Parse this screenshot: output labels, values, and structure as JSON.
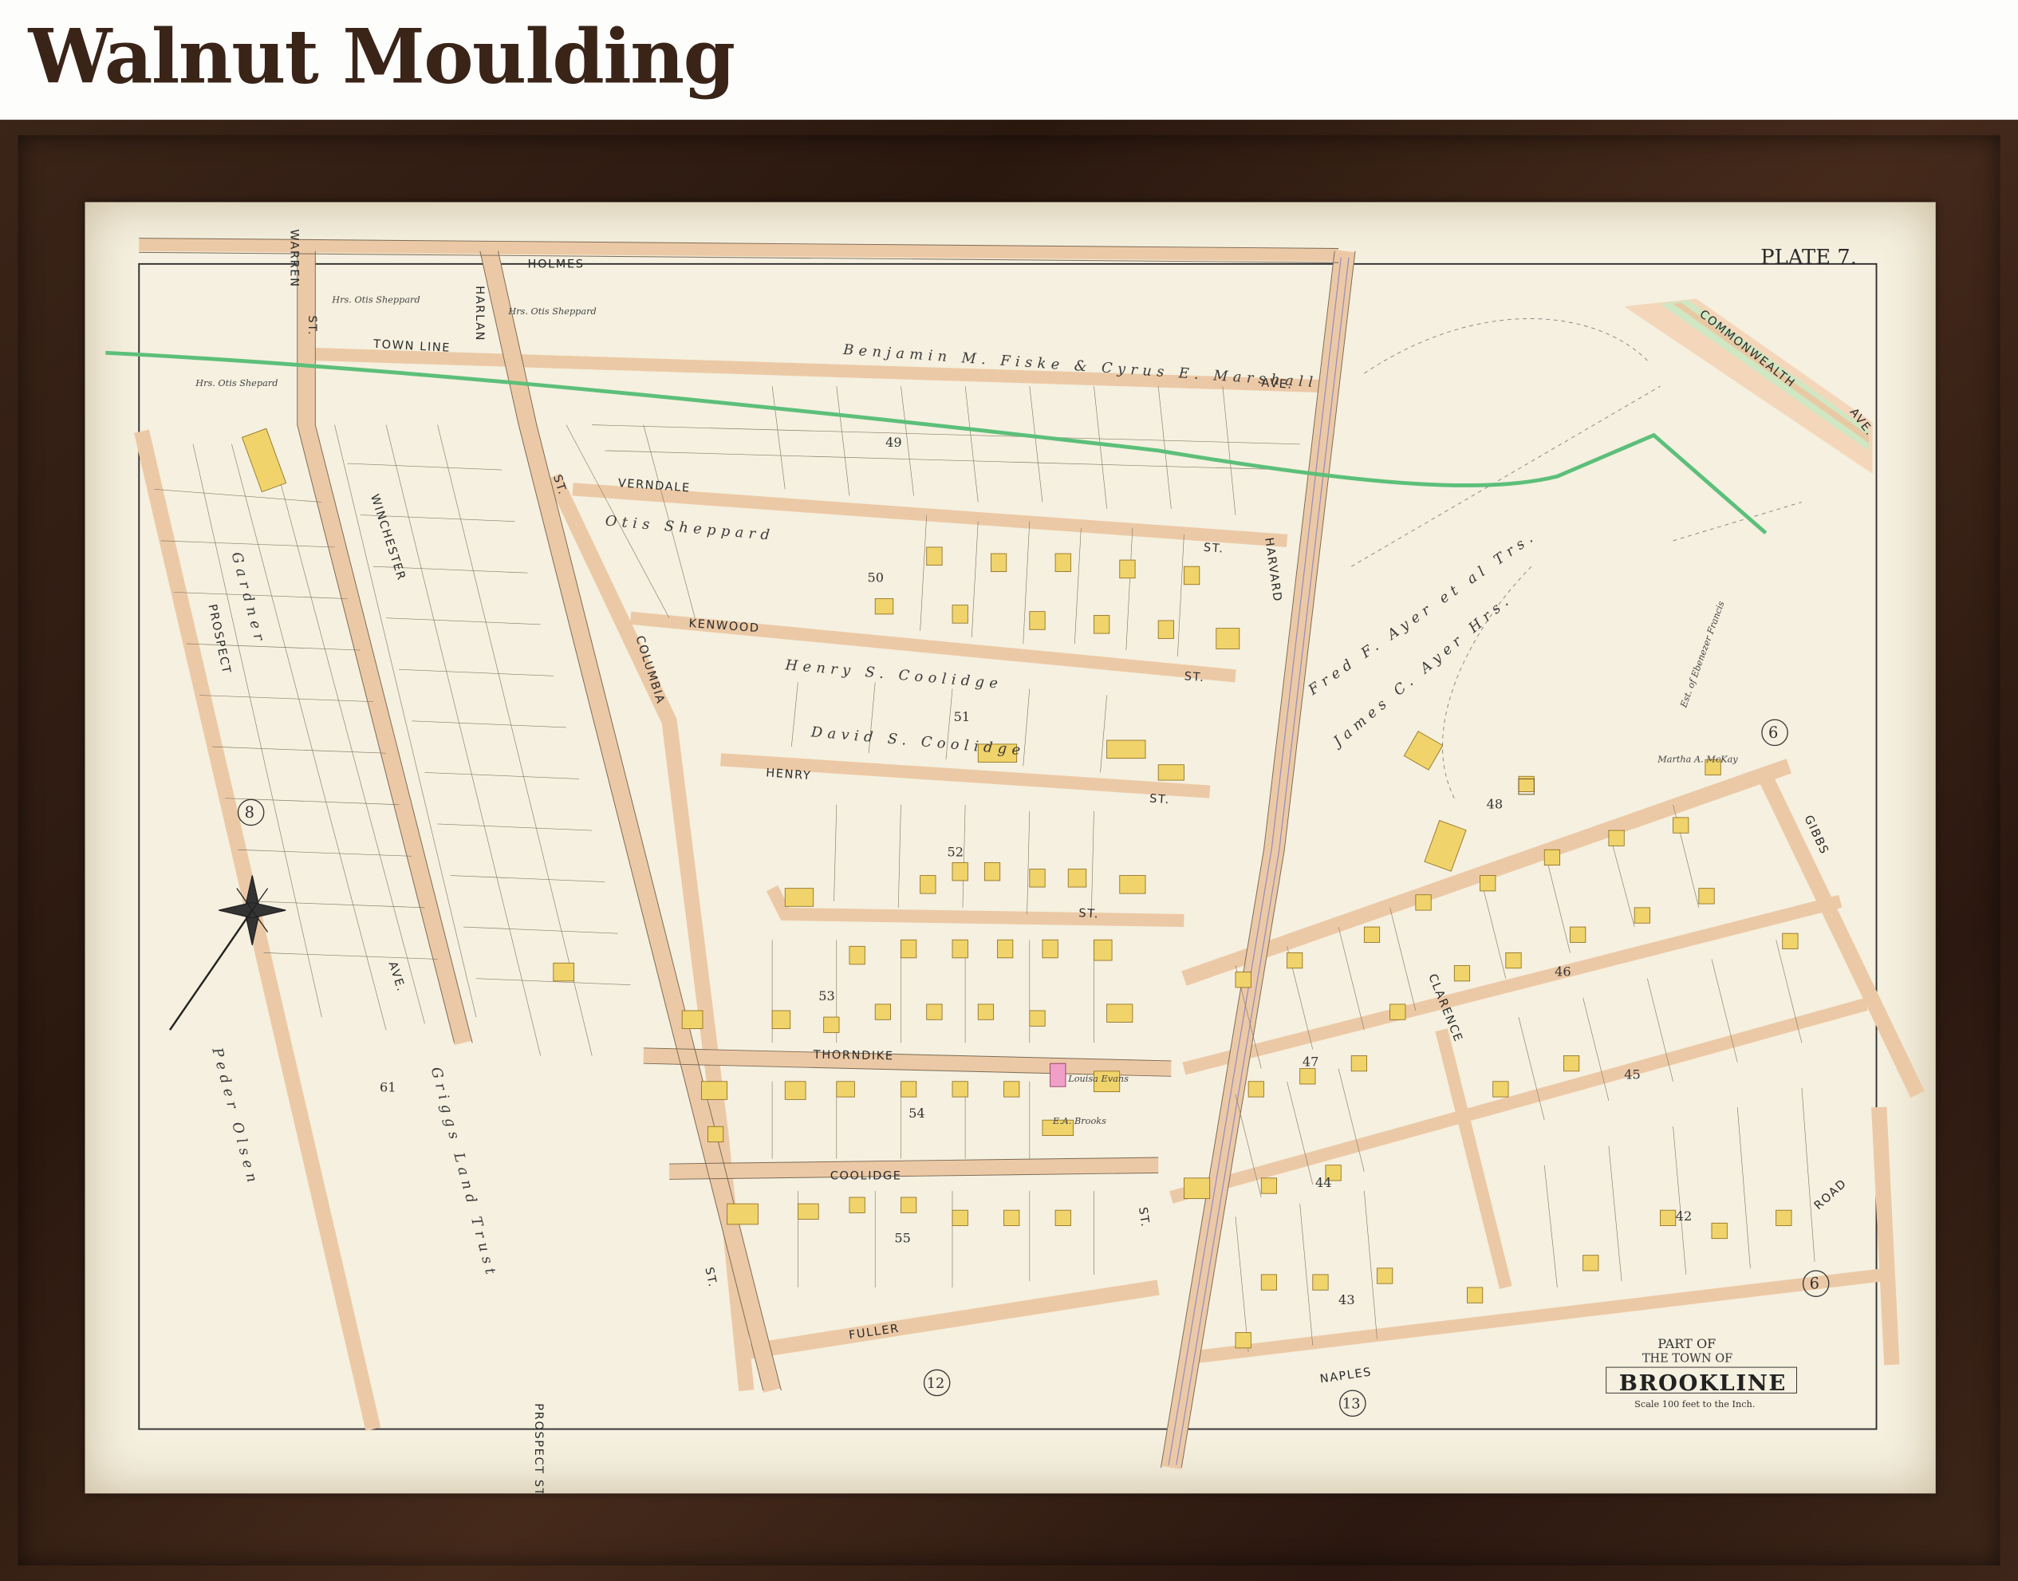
{
  "header": {
    "title": "Walnut Moulding"
  },
  "map": {
    "plate": "PLATE 7.",
    "cartouche": {
      "line1": "PART OF",
      "line2": "THE TOWN OF",
      "line3": "BROOKLINE",
      "scale": "Scale 100 feet to the Inch."
    },
    "streets": {
      "holmes": "HOLMES",
      "warren": "WARREN",
      "warren_st": "ST.",
      "harlan": "HARLAN",
      "town_line": "TOWN LINE",
      "ave": "AVE.",
      "verndale": "VERNDALE",
      "verndale_st": "ST.",
      "kenwood": "KENWOOD",
      "kenwood_st": "ST.",
      "henry": "HENRY",
      "henry_st": "ST.",
      "prospect": "PROSPECT",
      "winchester": "WINCHESTER",
      "columbia": "COLUMBIA",
      "harvard": "HARVARD",
      "harlan_st": "ST.",
      "winchester_ave": "AVE.",
      "thorndike": "THORNDIKE",
      "coolidge": "COOLIDGE",
      "fuller": "FULLER",
      "naples": "NAPLES",
      "clarence": "CLARENCE",
      "gibbs": "GIBBS",
      "road": "ROAD",
      "commonwealth": "COMMONWEALTH",
      "commonwealth_ave": "AVE.",
      "prospect_st": "PROSPECT ST.",
      "st_generic": "ST.",
      "columbia_st": "ST.",
      "harvard_st": "ST."
    },
    "block_numbers": [
      "49",
      "50",
      "51",
      "52",
      "53",
      "54",
      "55",
      "48",
      "46",
      "47",
      "45",
      "44",
      "43",
      "42",
      "61"
    ],
    "circled": [
      "8",
      "6",
      "6",
      "12",
      "13"
    ],
    "owners": {
      "otis1": "Hrs. Otis Sheppard",
      "otis2": "Hrs. Otis Sheppard",
      "otis_shepard": "Hrs. Otis Shepard",
      "fiske": "Benjamin M. Fiske & Cyrus E. Marshall",
      "garden": "Gardner",
      "griggs_land": "Griggs Land Trust",
      "peder": "Peder Olsen",
      "ayer1": "James C. Ayer Hrs.",
      "ayer2": "Fred F. Ayer et al Trs.",
      "coolidge_hrs": "Henry S. Coolidge",
      "david_coolidge": "David S. Coolidge",
      "otis_mid": "Otis Sheppard",
      "francis": "Est. of Ebenezer Francis",
      "mckay": "Martha A. McKay",
      "louisa": "Louisa Evans",
      "brooks": "E.A. Brooks"
    }
  }
}
